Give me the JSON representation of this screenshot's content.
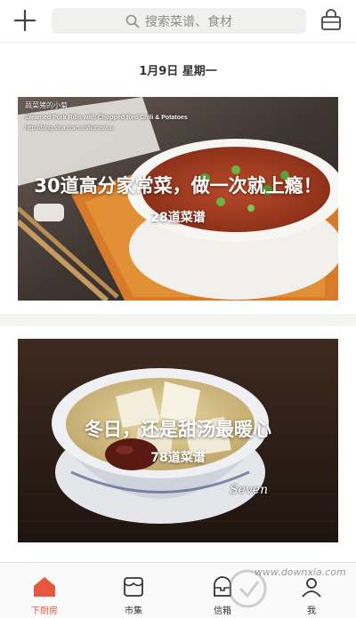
{
  "search": {
    "placeholder": "搜索菜谱、食材"
  },
  "feed": {
    "date": "1月9日 星期一",
    "cards": [
      {
        "title": "30道高分家常菜，做一次就上瘾！",
        "count": "28道菜谱",
        "watermark_lines": [
          "蔬菜猪的小菊",
          "Steamed Pork Ribs with Chopped Red Chili & Potatoes",
          "http://blog.sina.com.cn/lionawuu"
        ]
      },
      {
        "title": "冬日，还是甜汤最暖心",
        "count": "78道菜谱",
        "signature": "Seven"
      }
    ]
  },
  "tabbar": {
    "items": [
      {
        "label": "下厨房",
        "icon": "home-icon",
        "active": true
      },
      {
        "label": "市集",
        "icon": "market-icon",
        "active": false
      },
      {
        "label": "信箱",
        "icon": "mailbox-icon",
        "active": false
      },
      {
        "label": "我",
        "icon": "profile-icon",
        "active": false
      }
    ]
  },
  "overlay_watermark": "www.downxia.com",
  "colors": {
    "accent": "#e9563e",
    "search_bg": "#f0f0ee"
  }
}
